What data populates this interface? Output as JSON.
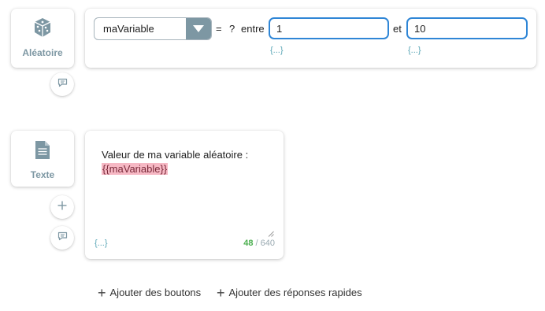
{
  "random_block": {
    "label": "Aléatoire",
    "icon": "dice-icon",
    "variable": "maVariable",
    "equals": "=",
    "question": "?",
    "between": "entre",
    "min_value": "1",
    "and": "et",
    "max_value": "10",
    "min_var_link": "{...}",
    "max_var_link": "{...}"
  },
  "text_block": {
    "label": "Texte",
    "icon": "document-icon",
    "line1": "Valeur de ma variable aléatoire :",
    "variable_tag": "{{maVariable}}",
    "var_link": "{...}",
    "char_count": "48",
    "char_separator": " / ",
    "char_max": "640"
  },
  "actions": {
    "add_buttons": "Ajouter des boutons",
    "add_quick_replies": "Ajouter des réponses rapides"
  },
  "colors": {
    "accent_blue": "#2f86d6",
    "slate": "#7d97a3",
    "variable_pink": "#f6b8c4",
    "count_green": "#4caf50"
  }
}
